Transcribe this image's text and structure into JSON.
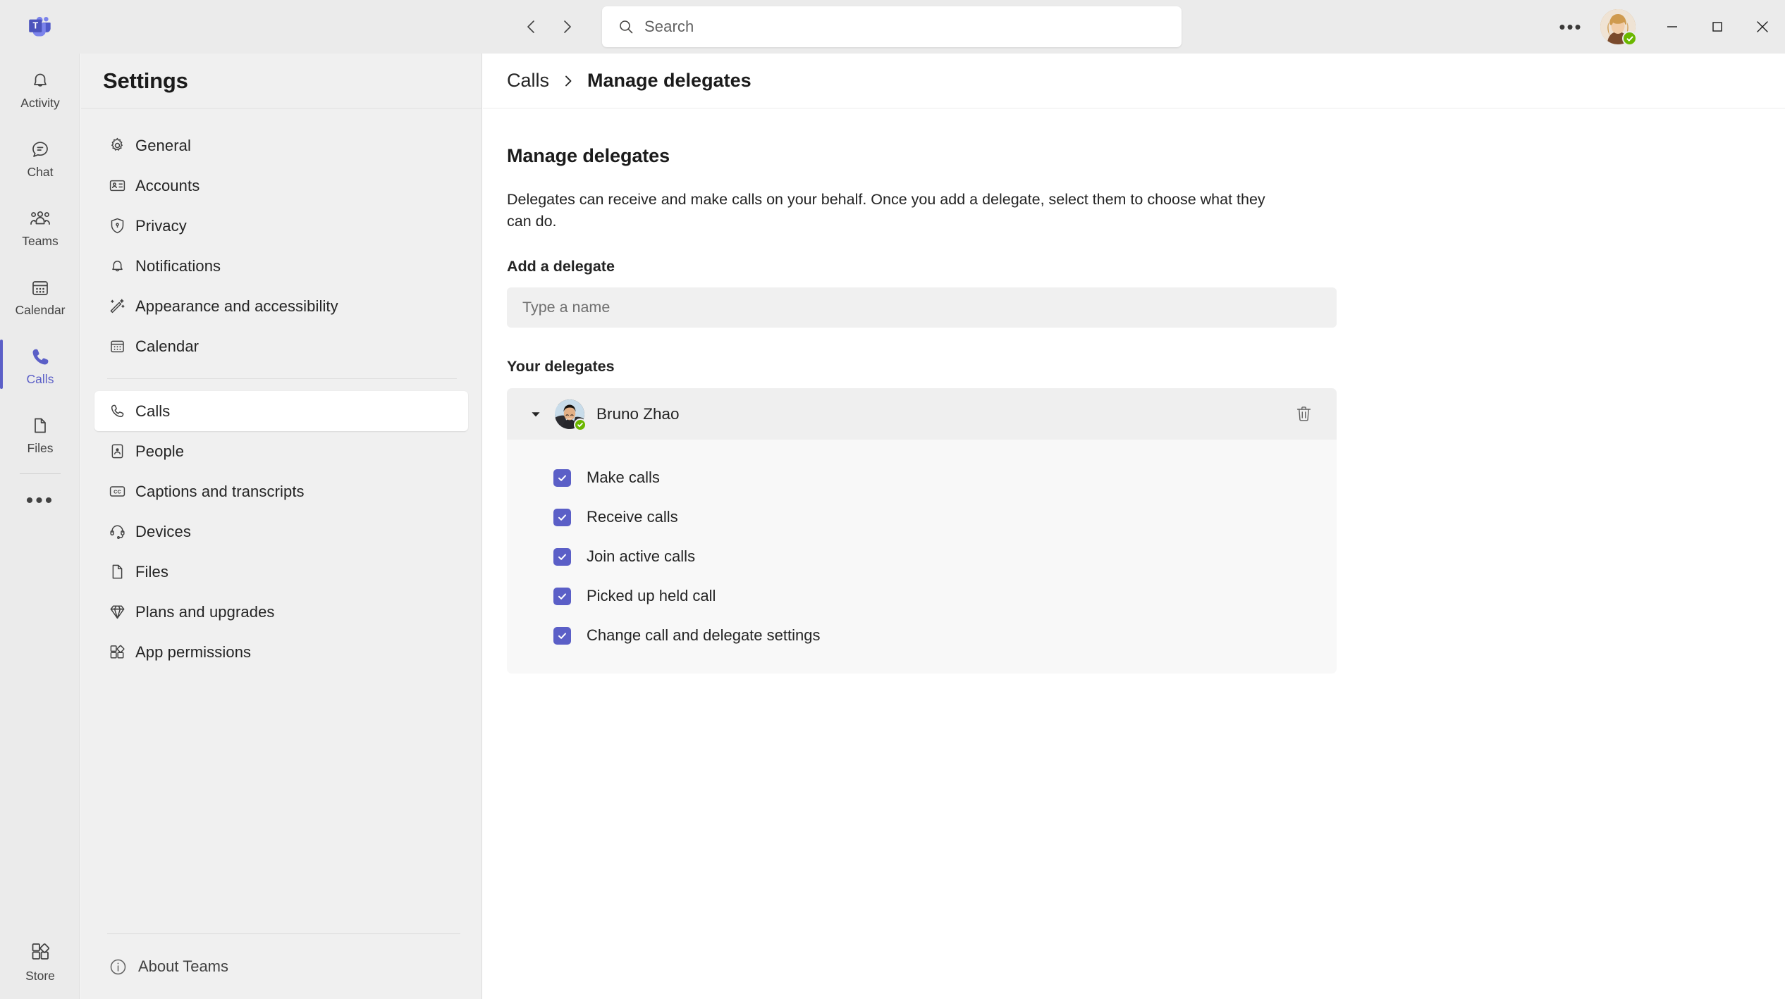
{
  "titlebar": {
    "logo_name": "teams-logo",
    "back_label": "Back",
    "forward_label": "Forward",
    "search": {
      "placeholder": "Search",
      "value": ""
    },
    "more_label": "•••",
    "avatar_status": "available",
    "minimize_label": "Minimize",
    "maximize_label": "Maximize",
    "close_label": "Close"
  },
  "app_rail": {
    "items": [
      {
        "label": "Activity",
        "icon": "bell-icon",
        "selected": false
      },
      {
        "label": "Chat",
        "icon": "chat-icon",
        "selected": false
      },
      {
        "label": "Teams",
        "icon": "teams-people-icon",
        "selected": false
      },
      {
        "label": "Calendar",
        "icon": "calendar-icon",
        "selected": false
      },
      {
        "label": "Calls",
        "icon": "phone-icon",
        "selected": true
      },
      {
        "label": "Files",
        "icon": "file-icon",
        "selected": false
      }
    ],
    "more_label": "•••",
    "store": {
      "label": "Store",
      "icon": "store-icon"
    }
  },
  "settings": {
    "title": "Settings",
    "items": [
      {
        "label": "General",
        "icon": "gear-icon",
        "selected": false
      },
      {
        "label": "Accounts",
        "icon": "contact-card-icon",
        "selected": false
      },
      {
        "label": "Privacy",
        "icon": "shield-lock-icon",
        "selected": false
      },
      {
        "label": "Notifications",
        "icon": "bell-icon",
        "selected": false
      },
      {
        "label": "Appearance and accessibility",
        "icon": "magic-wand-icon",
        "selected": false
      },
      {
        "label": "Calendar",
        "icon": "calendar-icon",
        "selected": false
      }
    ],
    "items2": [
      {
        "label": "Calls",
        "icon": "phone-icon",
        "selected": true
      },
      {
        "label": "People",
        "icon": "people-card-icon",
        "selected": false
      },
      {
        "label": "Captions and transcripts",
        "icon": "closed-caption-icon",
        "selected": false
      },
      {
        "label": "Devices",
        "icon": "headset-icon",
        "selected": false
      },
      {
        "label": "Files",
        "icon": "file-icon",
        "selected": false
      },
      {
        "label": "Plans and upgrades",
        "icon": "diamond-icon",
        "selected": false
      },
      {
        "label": "App permissions",
        "icon": "apps-icon",
        "selected": false
      }
    ],
    "about": {
      "label": "About Teams",
      "icon": "info-icon"
    }
  },
  "breadcrumb": {
    "parent": "Calls",
    "separator": "chevron-right-icon",
    "current": "Manage delegates"
  },
  "main": {
    "heading": "Manage delegates",
    "description": "Delegates can receive and make calls on your behalf. Once you add a delegate, select them to choose what they can do.",
    "add_label": "Add a delegate",
    "add_input": {
      "placeholder": "Type a name",
      "value": ""
    },
    "delegates_label": "Your delegates",
    "delegate": {
      "name": "Bruno Zhao",
      "presence": "available",
      "expanded": true,
      "delete_label": "Delete delegate",
      "permissions": [
        {
          "label": "Make calls",
          "checked": true
        },
        {
          "label": "Receive calls",
          "checked": true
        },
        {
          "label": "Join active calls",
          "checked": true
        },
        {
          "label": "Picked up held call",
          "checked": true
        },
        {
          "label": "Change call and delegate settings",
          "checked": true
        }
      ]
    }
  },
  "colors": {
    "accent": "#5b5fc7",
    "presence_available": "#6bb700",
    "titlebar_bg": "#ebebeb",
    "sidebar_bg": "#f0f0f0",
    "card_header_bg": "#efefef",
    "card_body_bg": "#f8f8f8"
  }
}
